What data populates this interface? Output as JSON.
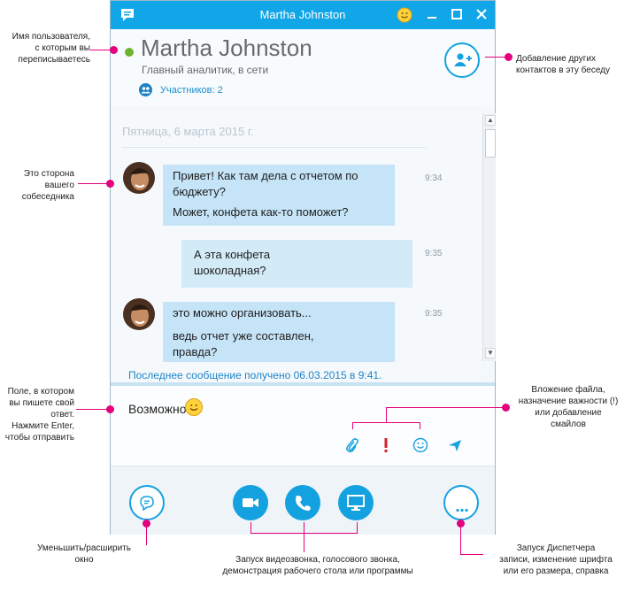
{
  "window": {
    "title": "Martha Johnston"
  },
  "contact": {
    "name": "Martha Johnston",
    "status": "Главный аналитик, в сети",
    "participants": "Участников: 2",
    "presence_color": "#6bb42f"
  },
  "chat": {
    "date": "Пятница, 6 марта 2015 г.",
    "messages": [
      {
        "text1": "Привет! Как там дела с отчетом по бюджету?",
        "text2": "Может, конфета как-то поможет?",
        "time": "9:34"
      },
      {
        "text1": "А эта конфета шоколадная?",
        "time": "9:35"
      },
      {
        "text1": "это можно организовать...",
        "text2": "ведь отчет уже составлен, правда?",
        "time": "9:35"
      }
    ],
    "last_message": "Последнее сообщение получено 06.03.2015 в 9:41."
  },
  "compose": {
    "value": "Возможно"
  },
  "icons": {
    "app": "chat-bubble-icon",
    "emoji": "smiley-icon",
    "minimize": "minimize-icon",
    "maximize": "maximize-icon",
    "close": "close-icon",
    "add_participants": "add-person-icon",
    "attach": "paperclip-icon",
    "importance": "exclamation-icon",
    "send": "send-icon",
    "video": "video-camera-icon",
    "call": "phone-icon",
    "present": "monitor-icon",
    "more": "ellipsis-icon"
  },
  "annotations": {
    "user_name": "Имя пользователя,\nс которым вы\nпереписываетесь",
    "other_side": "Это сторона\nвашего\nсобеседника",
    "input": "Поле, в котором\nвы пишете свой\nответ.\nНажмите Enter,\nчтобы отправить",
    "collapse": "Уменьшить/расширить\nокно",
    "add_contacts": "Добавление других\nконтактов в эту беседу",
    "attach": "Вложение файла,\nназначение важности (!)\nили добавление\nсмайлов",
    "media": "Запуск видеозвонка, голосового звонка,\nдемонстрация рабочего стола или программы",
    "more": "Запуск Диспетчера\nзаписи, изменение шрифта\nили его размера, справка"
  },
  "colors": {
    "accent": "#11a6e7",
    "callout": "#e5007e",
    "bubble": "#c6e4f7"
  }
}
